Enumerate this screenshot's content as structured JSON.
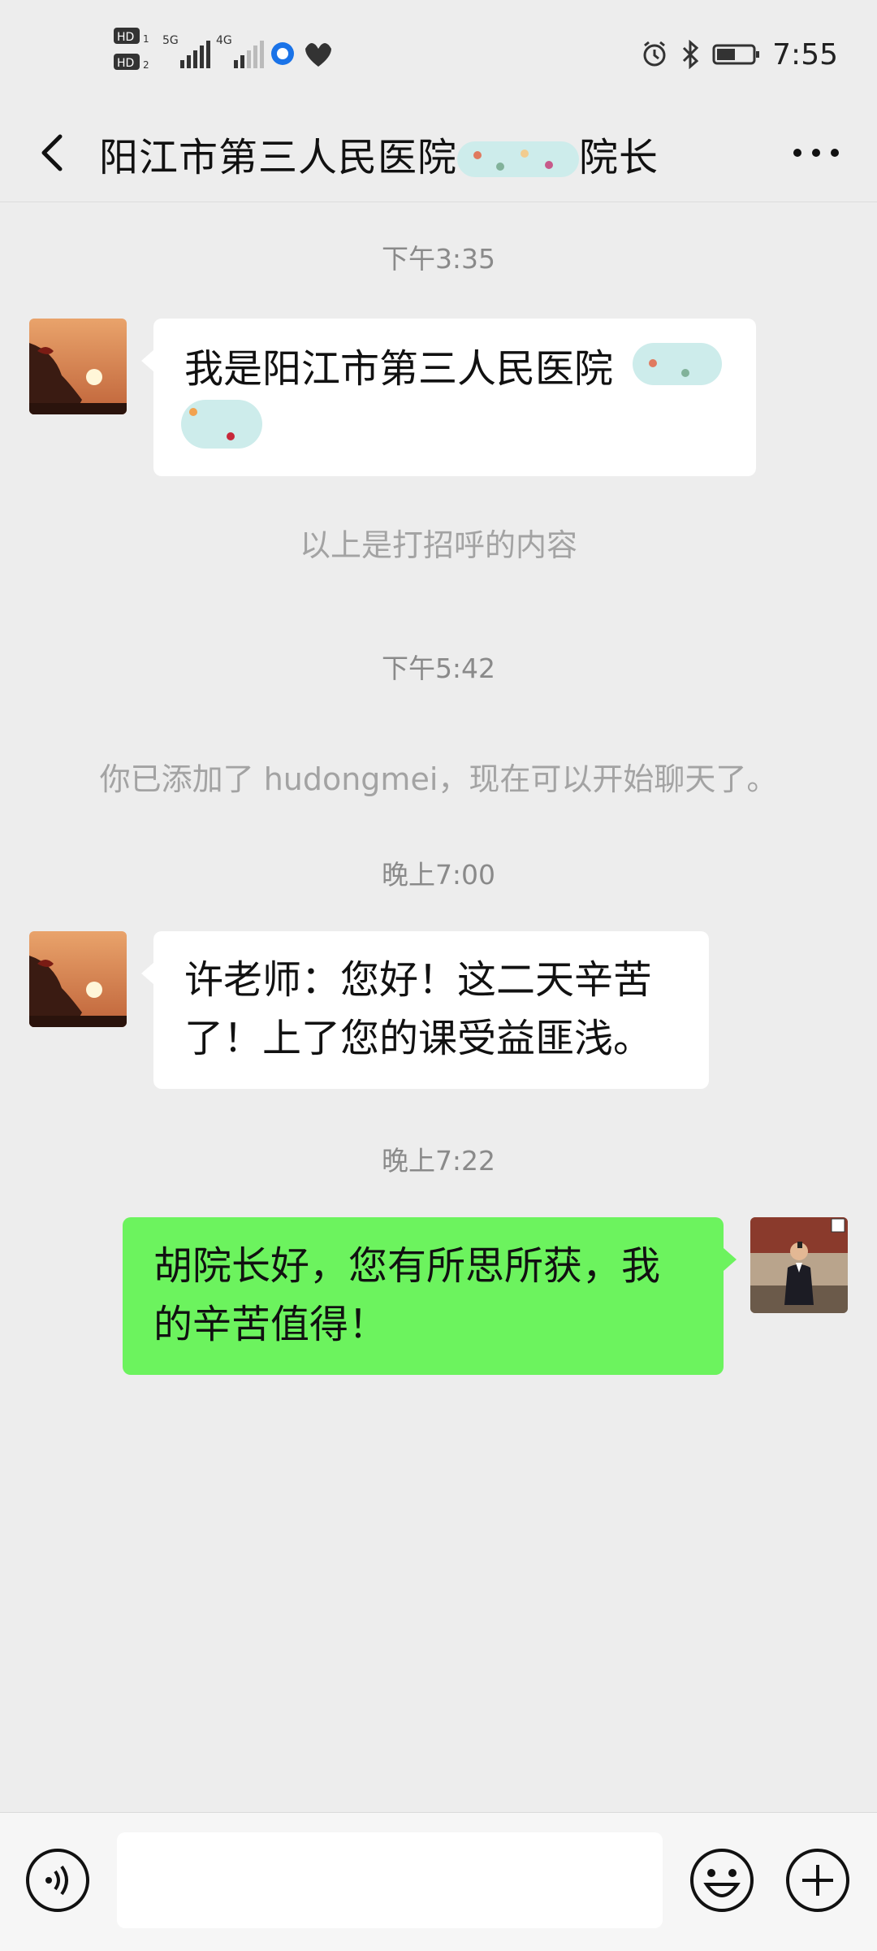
{
  "status_bar": {
    "sim1_label": "HD",
    "sim2_label": "HD",
    "net1": "5G",
    "net2": "4G",
    "time": "7:55",
    "icons": [
      "alarm-icon",
      "bluetooth-icon",
      "battery-icon"
    ]
  },
  "nav": {
    "title": "阳江市第三人民医院",
    "title_suffix": "院长",
    "back_icon": "back-chevron-icon",
    "more_icon": "more-dots-icon"
  },
  "messages": {
    "t1": "下午3:35",
    "m1": "我是阳江市第三人民医院",
    "m1_line2": "",
    "s1": "以上是打招呼的内容",
    "t2": "下午5:42",
    "s2": "你已添加了 hudongmei，现在可以开始聊天了。",
    "t3": "晚上7:00",
    "m2_line1": "许老师：您好！这二天辛苦",
    "m2_line2": "了！上了您的课受益匪浅。",
    "t4": "晚上7:22",
    "m3_line1": "胡院长好，您有所思所获，我",
    "m3_line2": "的辛苦值得！"
  },
  "input_bar": {
    "voice_icon": "voice-icon",
    "emoji_icon": "emoji-icon",
    "plus_icon": "plus-icon",
    "text_value": ""
  },
  "colors": {
    "background": "#ededed",
    "outgoing_bubble": "#6cf35e",
    "incoming_bubble": "#ffffff"
  }
}
